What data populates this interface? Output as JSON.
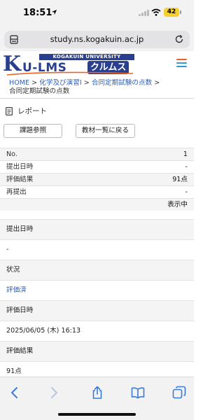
{
  "status": {
    "time": "18:51",
    "battery": "42"
  },
  "browser": {
    "url": "study.ns.kogakuin.ac.jp"
  },
  "logo": {
    "university": "KOGAKUIN UNIVERSITY",
    "letter_k": "K",
    "lms": "U-LMS",
    "kana": "クルムス"
  },
  "breadcrumb": {
    "home": "HOME",
    "course": "化学及び演習Ⅰ",
    "section": "合同定期試験の点数",
    "current": "合同定期試験の点数",
    "sep": ">"
  },
  "report": {
    "title": "レポート",
    "btn_view": "課題参照",
    "btn_back": "教材一覧に戻る"
  },
  "summary": {
    "rows": [
      {
        "key": "No.",
        "value": "1"
      },
      {
        "key": "提出日時",
        "value": "-"
      },
      {
        "key": "評価結果",
        "value": "91点"
      },
      {
        "key": "再提出",
        "value": "-"
      }
    ],
    "footer_value": "表示中"
  },
  "detail": {
    "submitted_label": "提出日時",
    "submitted_value": "-",
    "status_label": "状況",
    "status_value": "評価済",
    "eval_date_label": "評価日時",
    "eval_date_value": "2025/06/05 (木) 16:13",
    "result_label": "評価結果",
    "result_value": "91点"
  },
  "colors": {
    "brand": "#2a3f8f",
    "link": "#2f5fb0",
    "menu_accent": "#e8632a",
    "menu_lines": "#2f9ad8"
  }
}
